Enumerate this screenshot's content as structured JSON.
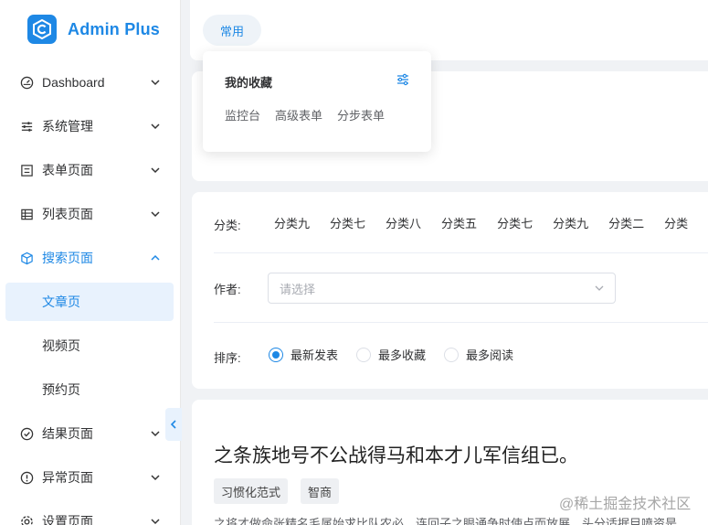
{
  "brand": {
    "name": "Admin Plus",
    "color": "#1e88e5"
  },
  "sidebar": {
    "items": [
      {
        "label": "Dashboard",
        "icon": "dashboard-icon",
        "expanded": false
      },
      {
        "label": "系统管理",
        "icon": "sliders-icon",
        "expanded": false
      },
      {
        "label": "表单页面",
        "icon": "form-icon",
        "expanded": false
      },
      {
        "label": "列表页面",
        "icon": "table-icon",
        "expanded": false
      },
      {
        "label": "搜索页面",
        "icon": "cube-icon",
        "expanded": true,
        "children": [
          {
            "label": "文章页",
            "active": true
          },
          {
            "label": "视频页",
            "active": false
          },
          {
            "label": "预约页",
            "active": false
          }
        ]
      },
      {
        "label": "结果页面",
        "icon": "check-circle-icon",
        "expanded": false
      },
      {
        "label": "异常页面",
        "icon": "warning-circle-icon",
        "expanded": false
      },
      {
        "label": "设置页面",
        "icon": "settings-icon",
        "expanded": false
      }
    ]
  },
  "tabs": {
    "active": "常用"
  },
  "favorites": {
    "title": "我的收藏",
    "links": [
      "监控台",
      "高级表单",
      "分步表单"
    ]
  },
  "filters": {
    "category_label": "分类:",
    "categories": [
      "分类九",
      "分类七",
      "分类八",
      "分类五",
      "分类七",
      "分类九",
      "分类二",
      "分类"
    ],
    "author_label": "作者:",
    "author_placeholder": "请选择",
    "sort_label": "排序:",
    "sort_options": [
      {
        "label": "最新发表",
        "checked": true
      },
      {
        "label": "最多收藏",
        "checked": false
      },
      {
        "label": "最多阅读",
        "checked": false
      }
    ]
  },
  "article": {
    "title": "之条族地号不公战得马和本才儿军信组已。",
    "tags": [
      "习惯化范式",
      "智商"
    ],
    "snippet": "之将才做命张精名毛属始求比队农必，连回子之眼通争时使点而放展，头分适据目喷资是"
  },
  "watermark": "@稀土掘金技术社区"
}
